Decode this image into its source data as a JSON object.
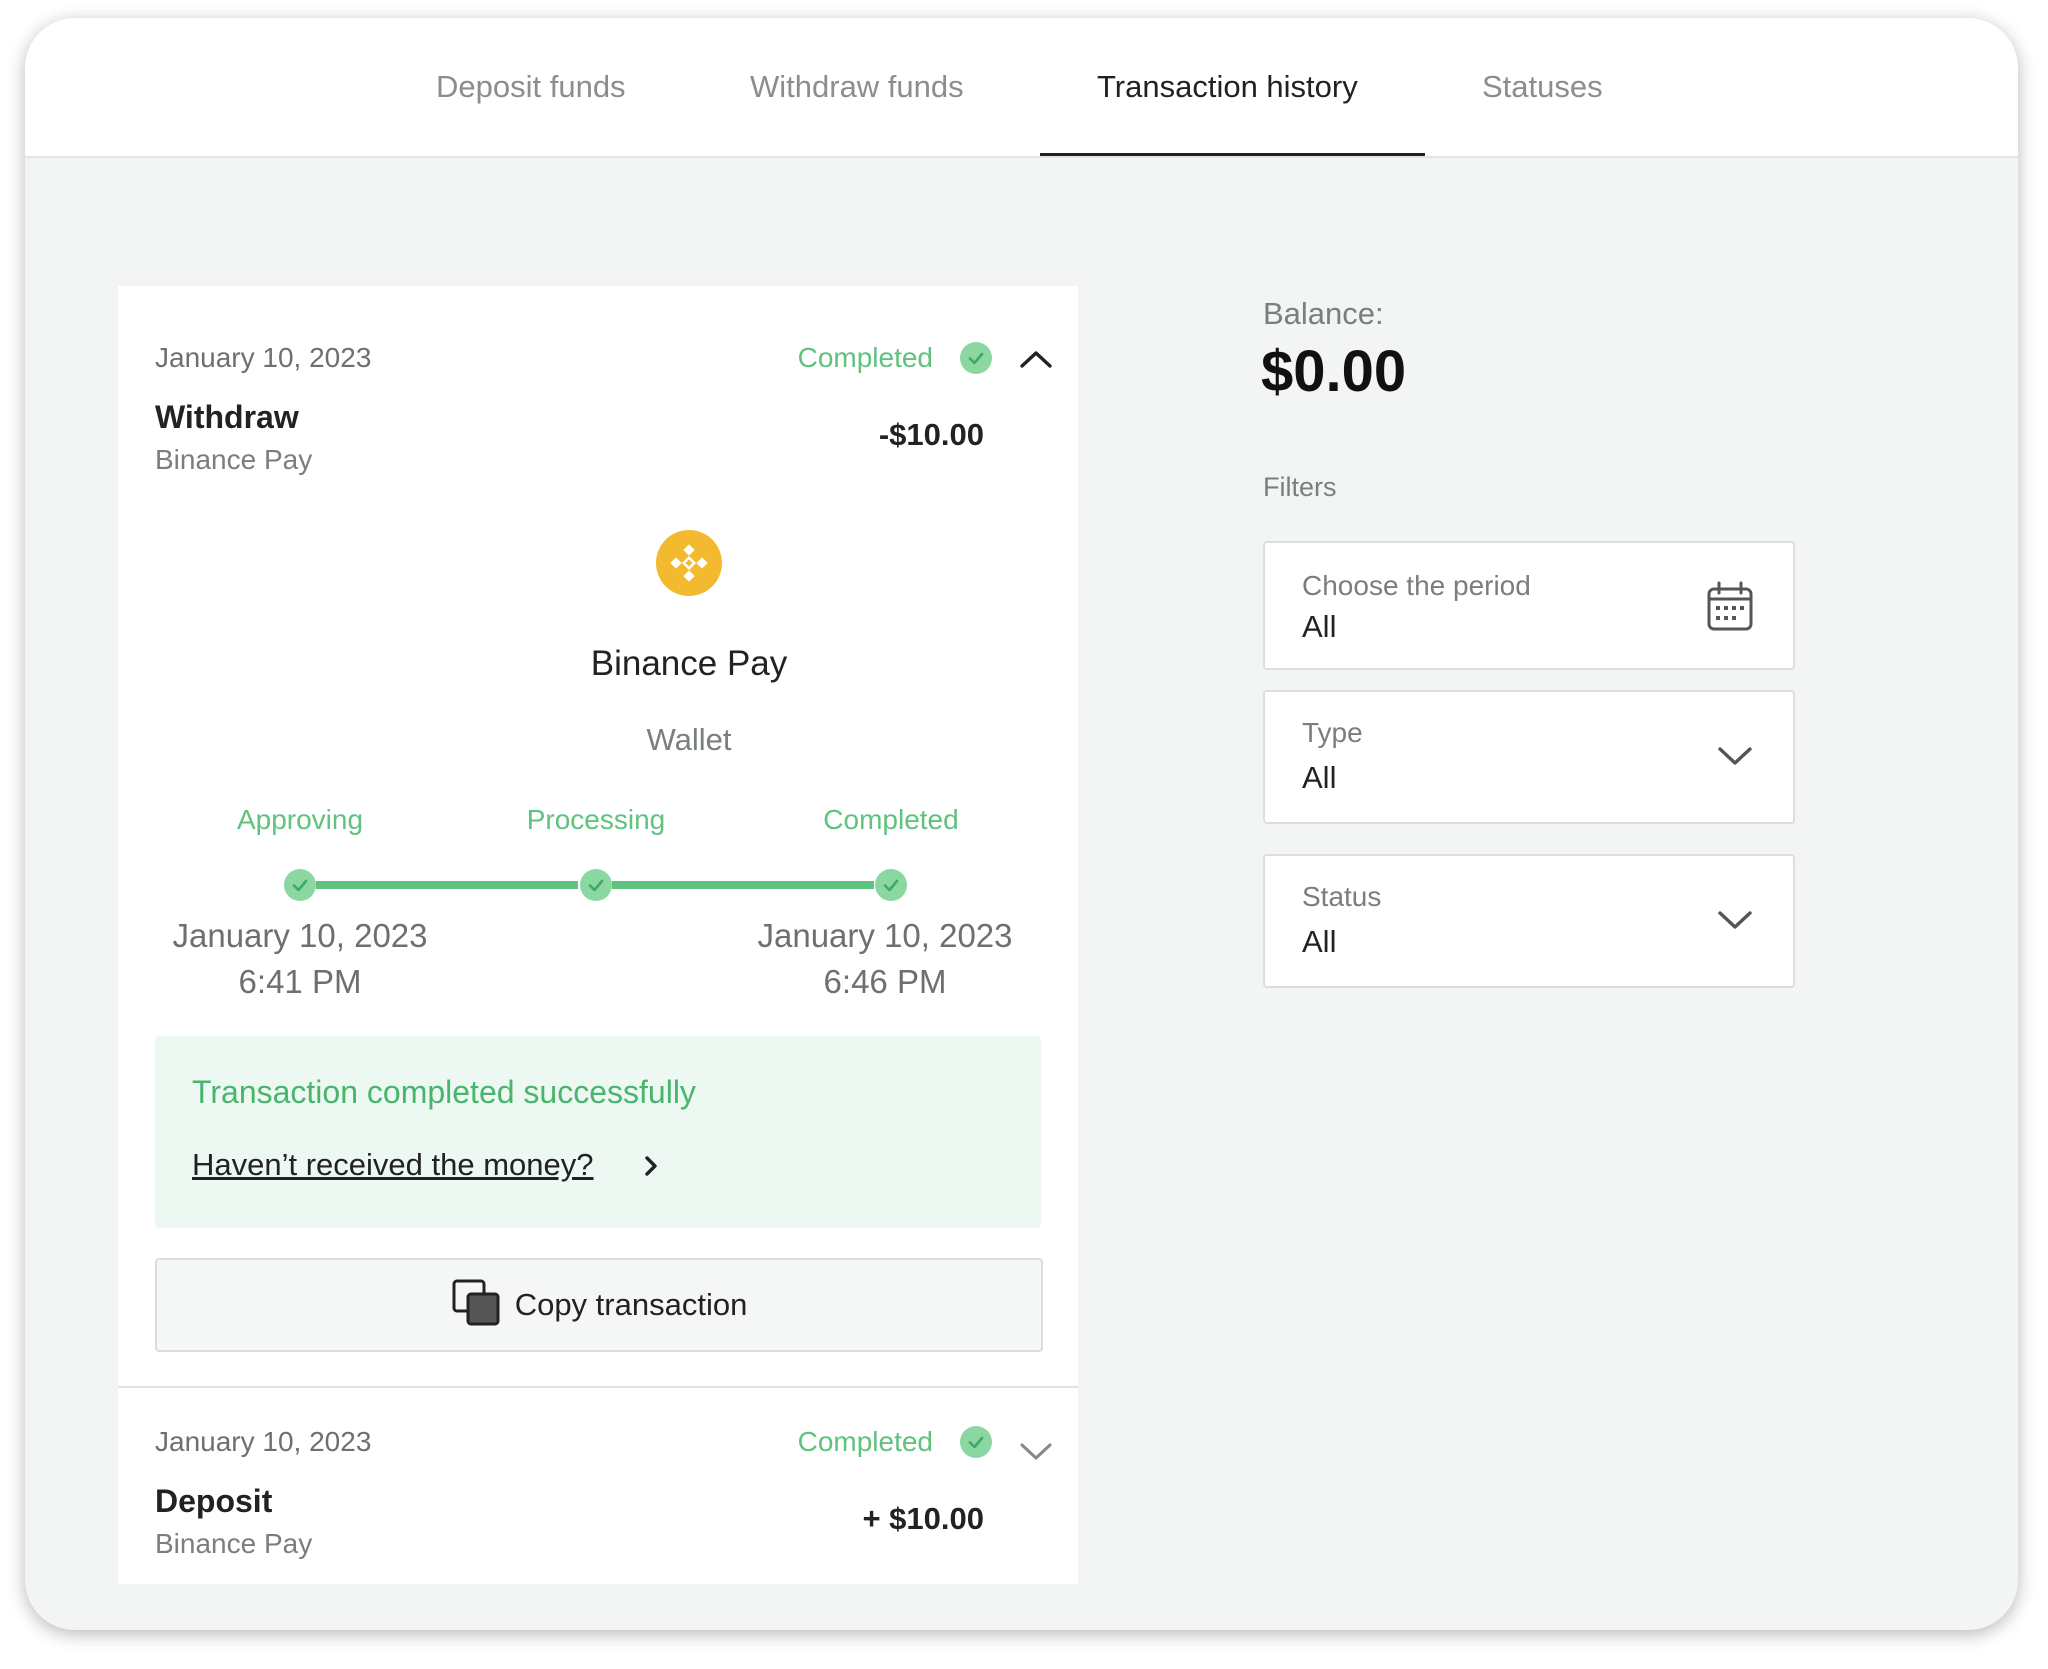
{
  "tabs": [
    {
      "label": "Deposit funds"
    },
    {
      "label": "Withdraw funds"
    },
    {
      "label": "Transaction history",
      "active": true
    },
    {
      "label": "Statuses"
    }
  ],
  "transactions": [
    {
      "date": "January 10, 2023",
      "status": "Completed",
      "type": "Withdraw",
      "method": "Binance Pay",
      "amount": "-$10.00",
      "expanded": true,
      "details": {
        "method_name": "Binance Pay",
        "method_type": "Wallet",
        "steps": [
          {
            "label": "Approving",
            "date": "January 10, 2023",
            "time": "6:41 PM"
          },
          {
            "label": "Processing"
          },
          {
            "label": "Completed",
            "date": "January 10, 2023",
            "time": "6:46 PM"
          }
        ],
        "success_message": "Transaction completed successfully",
        "help_link": "Haven’t received the money?",
        "copy_button": "Copy transaction"
      }
    },
    {
      "date": "January 10, 2023",
      "status": "Completed",
      "type": "Deposit",
      "method": "Binance Pay",
      "amount": "+ $10.00",
      "expanded": false
    }
  ],
  "sidebar": {
    "balance_label": "Balance:",
    "balance_value": "$0.00",
    "filters_label": "Filters",
    "filters": [
      {
        "label": "Choose the period",
        "value": "All",
        "icon": "calendar-icon"
      },
      {
        "label": "Type",
        "value": "All",
        "icon": "chevron-down-icon"
      },
      {
        "label": "Status",
        "value": "All",
        "icon": "chevron-down-icon"
      }
    ]
  },
  "colors": {
    "success": "#5fc27e",
    "success_bg": "#eef8f2",
    "binance": "#f3ba2f"
  }
}
